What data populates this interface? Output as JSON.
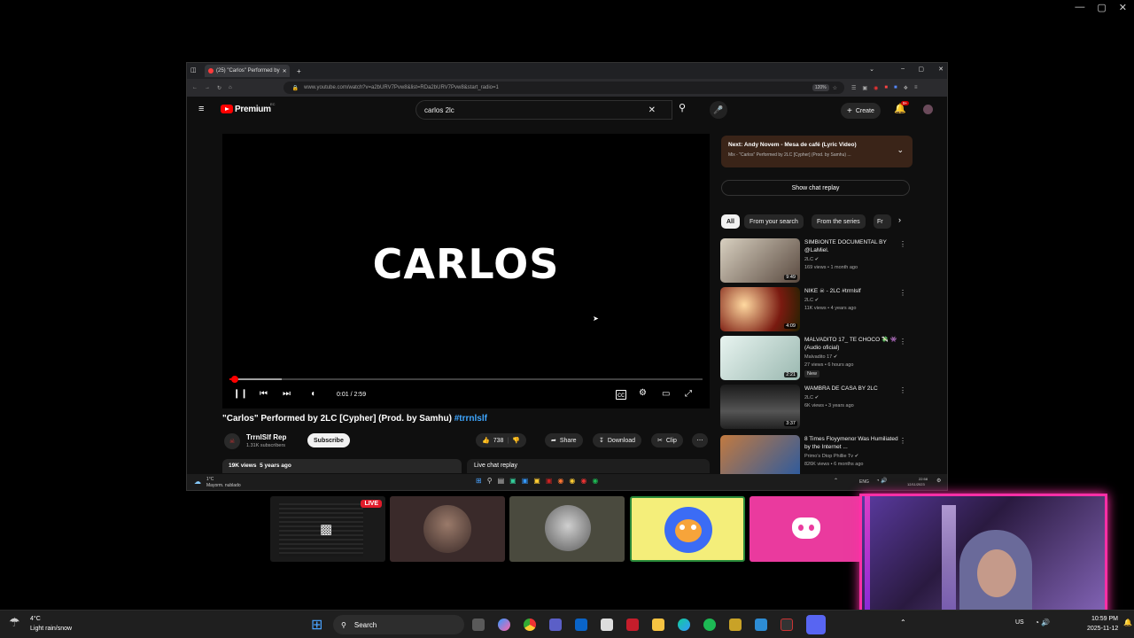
{
  "browser": {
    "tab_title": "(25) \"Carlos\" Performed by",
    "url": "www.youtube.com/watch?v=a2bURV7Pvw8&list=RDa2bURV7Pvw8&start_radio=1",
    "zoom": "120%"
  },
  "youtube": {
    "logo_text": "Premium",
    "logo_region": "EC",
    "search_query": "carlos 2lc",
    "create_label": "Create",
    "notif_count": "9+",
    "player": {
      "overlay_title": "CARLOS",
      "time": "0:01 / 2:59",
      "progress": 0.011,
      "buffered": 0.11
    },
    "video": {
      "title": "\"Carlos\" Performed by 2LC [Cypher] (Prod. by Samhu) ",
      "hashtag": "#trrnlslf",
      "channel": "TrrnlSlf Rep",
      "subscribers": "1.31K subscribers",
      "subscribe_label": "Subscribe",
      "likes": "738",
      "share_label": "Share",
      "download_label": "Download",
      "clip_label": "Clip",
      "views": "19K views",
      "age": "5 years ago",
      "live_chat_replay": "Live chat replay"
    },
    "next": {
      "label": "Next: Andy Novem - Mesa de café (Lyric Video)",
      "sub": "Mix - \"Carlos\" Performed by 2LC [Cypher] (Prod. by Samhu) ..."
    },
    "show_chat_replay": "Show chat replay",
    "chips": [
      "All",
      "From your search",
      "From the series",
      "Fr"
    ],
    "recommendations": [
      {
        "title": "SIMBIONTE DOCUMENTAL BY @LaMiel.",
        "channel": "2LC",
        "meta": "169 views • 1 month ago",
        "duration": "9:49",
        "badge": ""
      },
      {
        "title": "NIKE ☠ - 2LC #trrnlslf",
        "channel": "2LC",
        "meta": "11K views • 4 years ago",
        "duration": "4:09",
        "badge": ""
      },
      {
        "title": "MALVADITO 17_ TE CHOCO 💸 👾 (Audio oficial)",
        "channel": "Malvadito 17",
        "meta": "27 views • 6 hours ago",
        "duration": "2:21",
        "badge": "New"
      },
      {
        "title": "WAMBRA DE CASA BY 2LC",
        "channel": "2LC",
        "meta": "6K views • 3 years ago",
        "duration": "3:37",
        "badge": ""
      },
      {
        "title": "8 Times Floyymenor Was Humiliated by the Internet ...",
        "channel": "Primo's Dtop Phillie Tv",
        "meta": "826K views • 6 months ago",
        "duration": "",
        "badge": ""
      }
    ]
  },
  "inner_taskbar": {
    "weather_temp": "1°C",
    "weather_desc": "Mayorm. nublado",
    "lang": "ENG",
    "time": "22:58",
    "date": "12/11/2023"
  },
  "overlay": {
    "live_label": "LIVE"
  },
  "taskbar": {
    "weather_temp": "4°C",
    "weather_desc": "Light rain/snow",
    "search_label": "Search",
    "region": "US",
    "time": "10:59 PM",
    "date": "2025-11-12"
  },
  "colors": {
    "accent": "#ff0000",
    "link": "#3ea6ff",
    "webcam_border": "#ff2fa6",
    "discord": "#ea3a9e",
    "mascot_tile": "#f4ee7a"
  }
}
